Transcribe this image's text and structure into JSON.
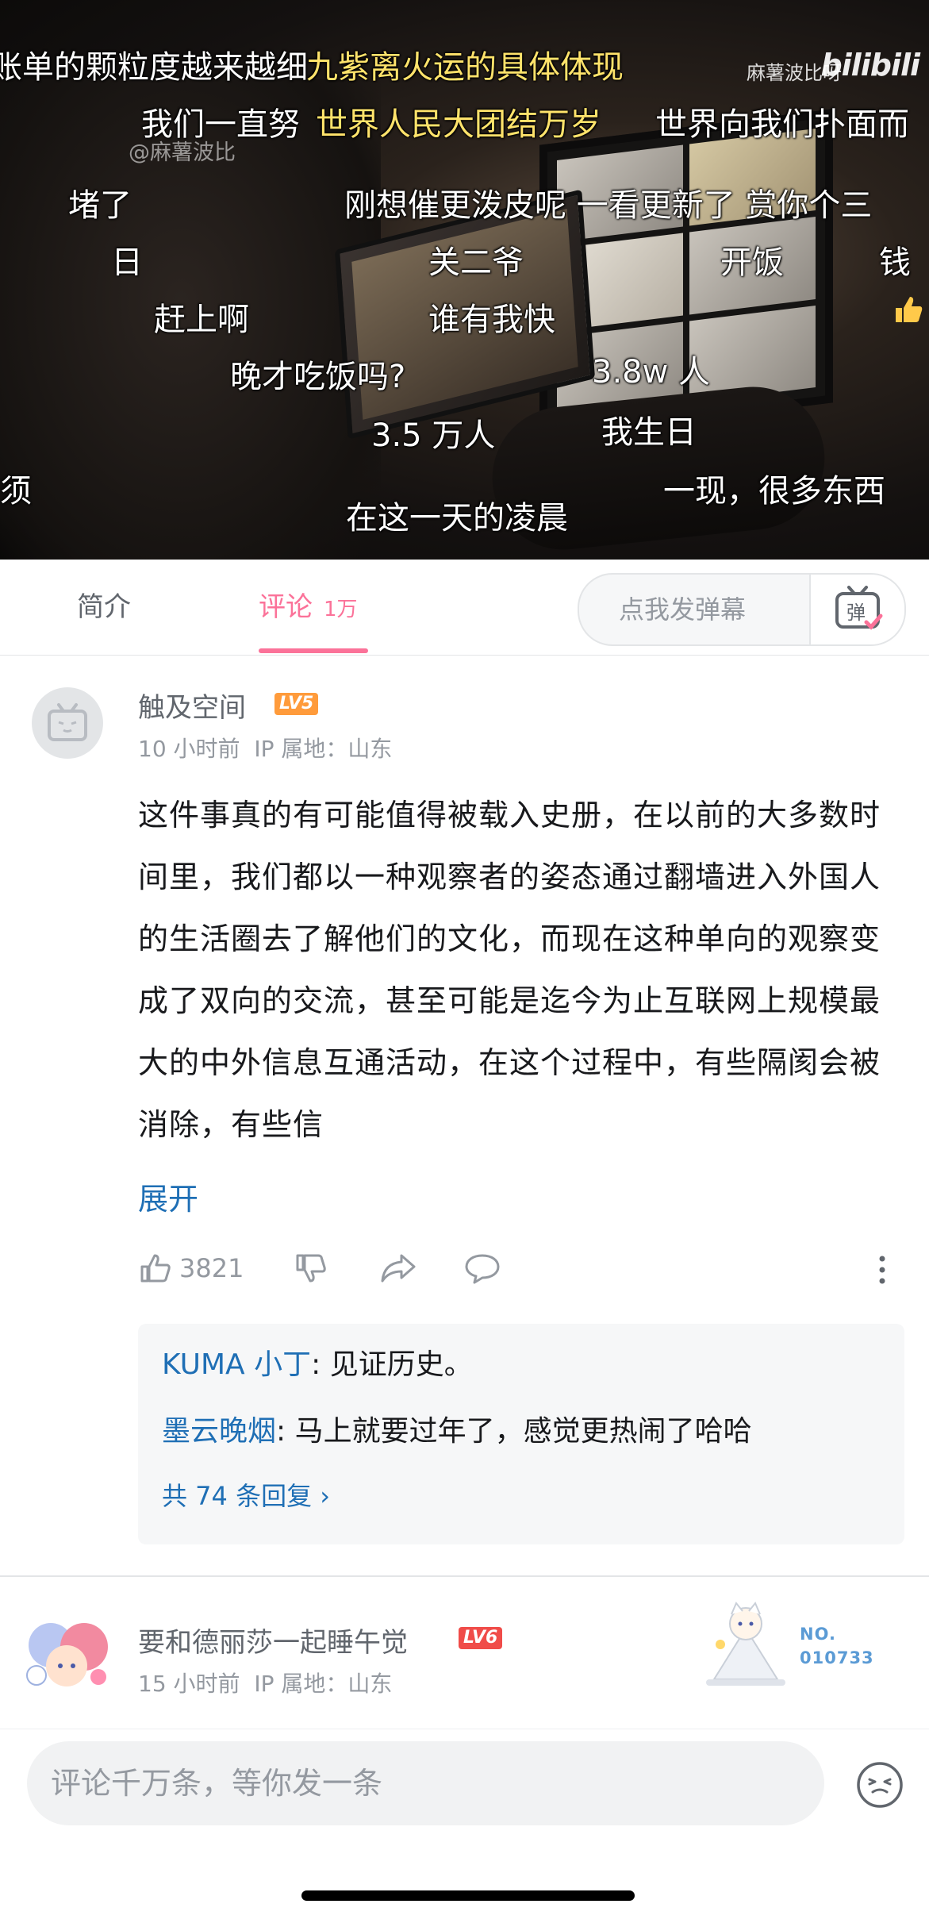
{
  "video": {
    "watermark": "@麻薯波比",
    "author_mark": "麻薯波比呀",
    "logo": "bilibili",
    "danmaku": [
      {
        "text": "账单的颗粒度越来越细",
        "yellow": false
      },
      {
        "text": "九紫离火运的具体体现",
        "yellow": true
      },
      {
        "text": "我们一直努",
        "yellow": false
      },
      {
        "text": "世界人民大团结万岁",
        "yellow": true
      },
      {
        "text": "世界向我们扑面而",
        "yellow": false
      },
      {
        "text": "堵了",
        "yellow": false
      },
      {
        "text": "刚想催更泼皮呢 一看更新了 赏你个三",
        "yellow": false
      },
      {
        "text": "日",
        "yellow": false
      },
      {
        "text": "关二爷",
        "yellow": false
      },
      {
        "text": "开饭",
        "yellow": false
      },
      {
        "text": "钱",
        "yellow": false
      },
      {
        "text": "赶上啊",
        "yellow": false
      },
      {
        "text": "谁有我快",
        "yellow": false
      },
      {
        "text": "晚才吃饭吗?",
        "yellow": false
      },
      {
        "text": "3.8w 人",
        "yellow": false
      },
      {
        "text": "3.5 万人",
        "yellow": false
      },
      {
        "text": "我生日",
        "yellow": false
      },
      {
        "text": "须",
        "yellow": false
      },
      {
        "text": "在这一天的凌晨",
        "yellow": false
      },
      {
        "text": "一现，很多东西",
        "yellow": false
      }
    ]
  },
  "tabs": {
    "intro": "简介",
    "comments": "评论",
    "comments_count": "1万",
    "danmu_placeholder": "点我发弹幕",
    "danmu_button_icon": "danmaku-icon"
  },
  "comment1": {
    "username": "触及空间",
    "level": "LV5",
    "level_color": "#ff9b3b",
    "time": "10 小时前",
    "ip": "IP 属地：山东",
    "content": "这件事真的有可能值得被载入史册，在以前的大多数时间里，我们都以一种观察者的姿态通过翻墙进入外国人的生活圈去了解他们的文化，而现在这种单向的观察变成了双向的交流，甚至可能是迄今为止互联网上规模最大的中外信息互通活动，在这个过程中，有些隔阂会被消除，有些信",
    "expand": "展开",
    "likes": "3821",
    "replies": [
      {
        "user": "KUMA 小丁",
        "text": ": 见证历史。"
      },
      {
        "user": "墨云晚烟",
        "text": ": 马上就要过年了，感觉更热闹了哈哈"
      }
    ],
    "reply_total": "共 74 条回复 ›"
  },
  "comment2": {
    "username": "要和德丽莎一起睡午觉",
    "level": "LV6",
    "level_color": "#f04c49",
    "time": "15 小时前",
    "ip": "IP 属地：山东",
    "fan_badge_line1": "NO.",
    "fan_badge_line2": "010733"
  },
  "bottom": {
    "placeholder": "评论千万条，等你发一条",
    "emoji_icon": "emoji-icon"
  },
  "colors": {
    "accent": "#fb7299",
    "link": "#1f6fb5",
    "muted": "#9499a0"
  }
}
